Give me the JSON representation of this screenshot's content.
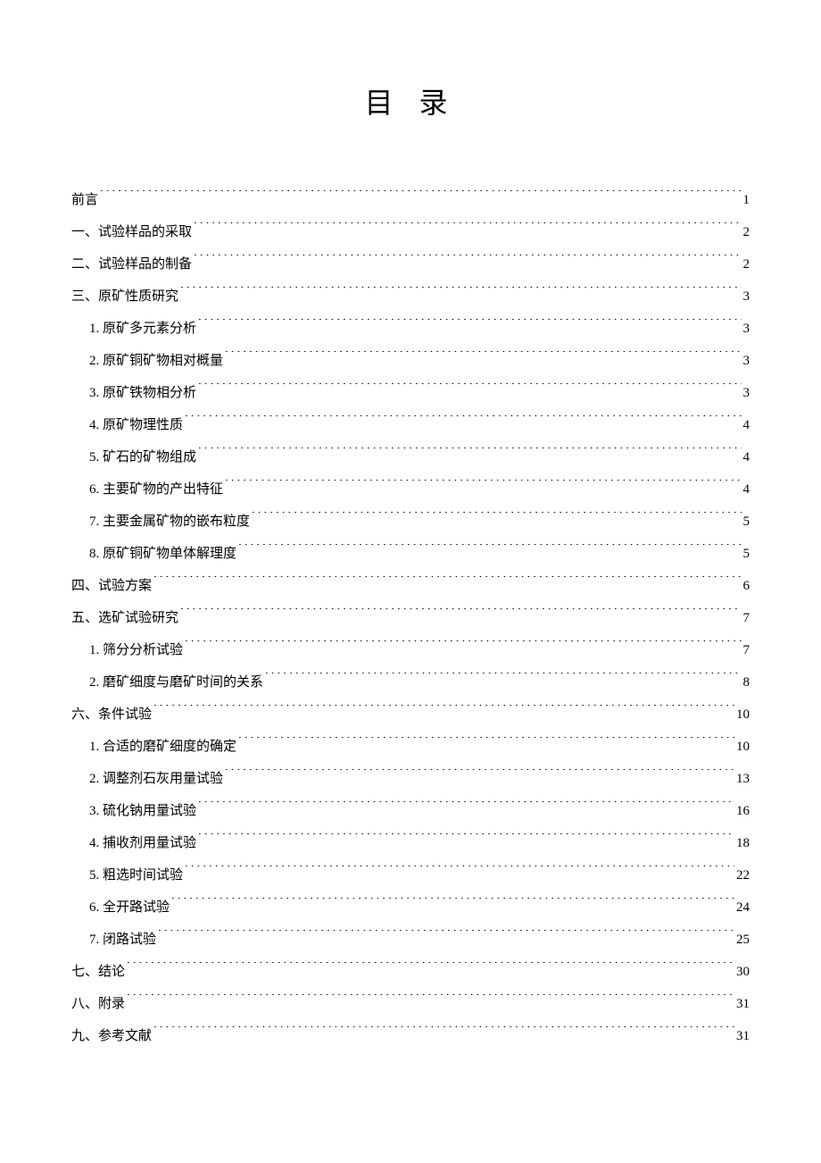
{
  "title": "目 录",
  "entries": [
    {
      "level": 1,
      "label": "前言",
      "page": "1"
    },
    {
      "level": 1,
      "label": "一、试验样品的采取",
      "page": "2"
    },
    {
      "level": 1,
      "label": "二、试验样品的制备",
      "page": "2"
    },
    {
      "level": 1,
      "label": "三、原矿性质研究",
      "page": "3"
    },
    {
      "level": 2,
      "label": "1. 原矿多元素分析",
      "page": "3"
    },
    {
      "level": 2,
      "label": "2. 原矿铜矿物相对概量",
      "page": "3"
    },
    {
      "level": 2,
      "label": "3. 原矿铁物相分析",
      "page": "3"
    },
    {
      "level": 2,
      "label": "4. 原矿物理性质",
      "page": "4"
    },
    {
      "level": 2,
      "label": "5. 矿石的矿物组成",
      "page": "4"
    },
    {
      "level": 2,
      "label": "6. 主要矿物的产出特征",
      "page": "4"
    },
    {
      "level": 2,
      "label": "7. 主要金属矿物的嵌布粒度",
      "page": "5"
    },
    {
      "level": 2,
      "label": "8. 原矿铜矿物单体解理度",
      "page": "5"
    },
    {
      "level": 1,
      "label": "四、试验方案",
      "page": "6"
    },
    {
      "level": 1,
      "label": "五、选矿试验研究",
      "page": "7"
    },
    {
      "level": 2,
      "label": "1. 筛分分析试验",
      "page": "7"
    },
    {
      "level": 2,
      "label": "2. 磨矿细度与磨矿时间的关系",
      "page": "8"
    },
    {
      "level": 1,
      "label": "六、条件试验",
      "page": "10"
    },
    {
      "level": 2,
      "label": "1. 合适的磨矿细度的确定",
      "page": "10"
    },
    {
      "level": 2,
      "label": "2. 调整剂石灰用量试验",
      "page": "13"
    },
    {
      "level": 2,
      "label": "3. 硫化钠用量试验",
      "page": "16"
    },
    {
      "level": 2,
      "label": "4. 捕收剂用量试验",
      "page": "18"
    },
    {
      "level": 2,
      "label": "5. 粗选时间试验",
      "page": "22"
    },
    {
      "level": 2,
      "label": "6. 全开路试验",
      "page": "24"
    },
    {
      "level": 2,
      "label": "7. 闭路试验",
      "page": "25"
    },
    {
      "level": 1,
      "label": "七、结论",
      "page": "30"
    },
    {
      "level": 1,
      "label": "八、附录",
      "page": "31"
    },
    {
      "level": 1,
      "label": "九、参考文献",
      "page": "31"
    }
  ]
}
